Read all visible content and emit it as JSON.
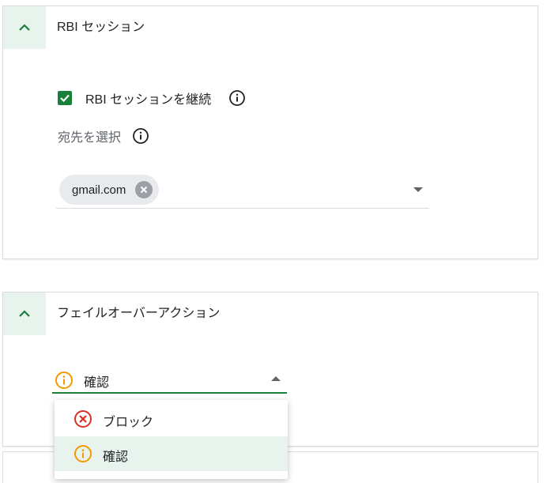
{
  "rbi_section": {
    "title": "RBI セッション",
    "continue_label": "RBI セッションを継続",
    "destination_label": "宛先を選択",
    "chip_value": "gmail.com"
  },
  "failover_section": {
    "title": "フェイルオーバーアクション",
    "selected_value": "確認",
    "menu_items": [
      {
        "label": "ブロック",
        "icon": "block-x-icon"
      },
      {
        "label": "確認",
        "icon": "warning-info-icon"
      }
    ]
  },
  "colors": {
    "accent": "#188038",
    "selected_bg": "#e8f3ee",
    "warning": "#f29900",
    "error": "#d93025"
  }
}
